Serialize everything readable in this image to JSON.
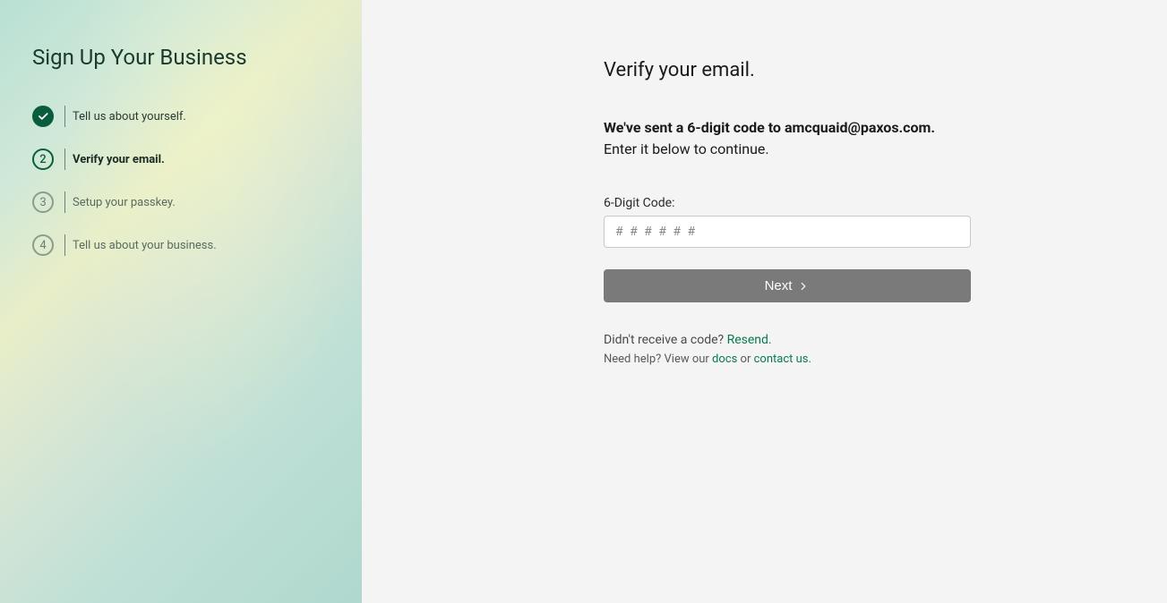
{
  "sidebar": {
    "title": "Sign Up Your Business",
    "steps": [
      {
        "number": "1",
        "label": "Tell us about yourself.",
        "state": "completed"
      },
      {
        "number": "2",
        "label": "Verify your email.",
        "state": "active"
      },
      {
        "number": "3",
        "label": "Setup your passkey.",
        "state": "pending"
      },
      {
        "number": "4",
        "label": "Tell us about your business.",
        "state": "pending"
      }
    ]
  },
  "main": {
    "title": "Verify your email.",
    "sent_prefix": "We've sent a 6-digit code to ",
    "sent_email": "amcquaid@paxos.com.",
    "enter_instruction": "Enter it below to continue.",
    "code_label": "6-Digit Code:",
    "code_placeholder": "# # # # # #",
    "next_label": "Next",
    "no_code_text": "Didn't receive a code? ",
    "resend_label": "Resend.",
    "help_prefix": "Need help? View our ",
    "docs_label": "docs",
    "help_mid": " or ",
    "contact_label": "contact us."
  }
}
